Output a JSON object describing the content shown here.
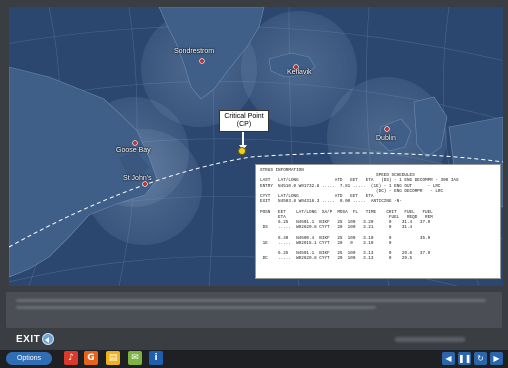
{
  "map": {
    "cities": [
      {
        "name": "Sondrestrom"
      },
      {
        "name": "Keflavik"
      },
      {
        "name": "Goose Bay"
      },
      {
        "name": "St John's"
      },
      {
        "name": "Dublin"
      }
    ],
    "critical_point": {
      "line1": "Critical Point",
      "line2": "(CP)"
    }
  },
  "nav_panel": {
    "lines": [
      "STRUS INFORMATION",
      "                                             SPEED SCHEDULES",
      "LAST   LAT/LONG              ATD   EET   ETA   (DS) - 1 ENG DECOMPR - 300 IAS",
      "ENTRY  N4510.0 W01732.8 .....  7.81 .....  (1E) - 1 ENG OUT      - LRC",
      "                                             (DC) - ENG DECOMPR   - LRC",
      "CYYT   LAT/LONG              ATD   EET   ETA",
      "EXIT   N4503.8 W04316.3 .....  0.00 .....  ANTICING -N-",
      "",
      "POSN   EET    LAT/LONG  SA/P  MOSA  FL   TIME    CRIT   FUEL   FUEL",
      "       ETA                                        FUEL   REQD   REM",
      "       6.25   N4501.1  BIKF   25  100   3.20      0    31.4   37.9",
      " DS    .....  W02620.8 CYYT   20  100   3.21      0    31.4",
      "",
      "       6.40   N4500.4  BIKF   25  100   3.10      0           35.9",
      " 1E    .....  W02915.1 CYYT   20   0    3.10      0",
      "",
      "       6.25   N4501.1  BIKF   25  100   3.13      0    29.6   37.9",
      " DC    .....  W02620.8 CYYT   20  100   3.13      0    29.5"
    ]
  },
  "footer": {
    "exit_label": "EXIT",
    "options_label": "Options"
  },
  "toolbar": {
    "icons": [
      "speaker-icon",
      "glossary-icon",
      "notes-icon",
      "chat-icon",
      "info-icon"
    ],
    "media": [
      "previous-icon",
      "pause-icon",
      "replay-icon",
      "next-icon"
    ]
  },
  "colors": {
    "ocean": "#2d4a73",
    "land": "#3f5f88",
    "city_marker": "#c23333",
    "cp_marker": "#f2d21b",
    "accent": "#2f6db5"
  }
}
